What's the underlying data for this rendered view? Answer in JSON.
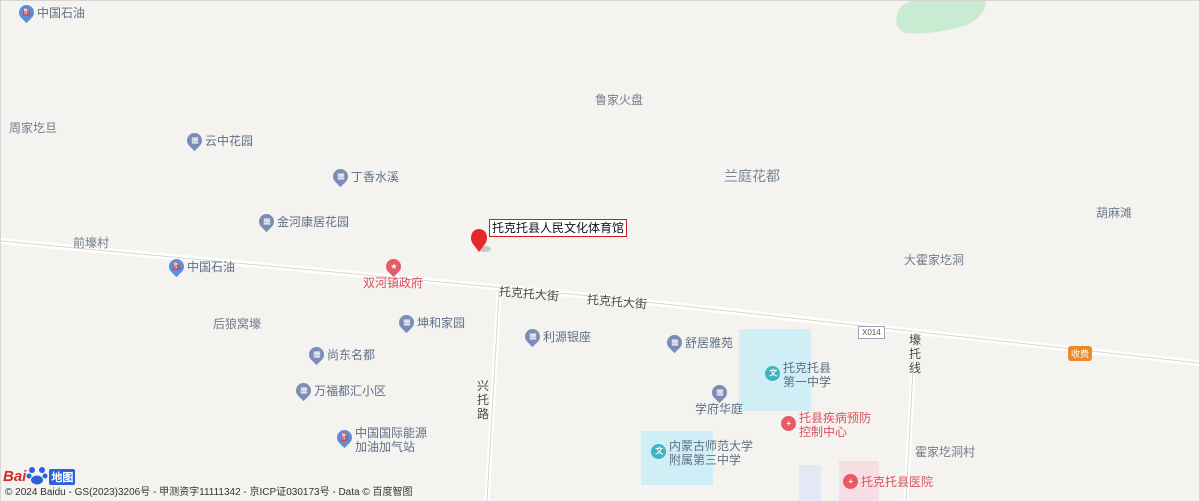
{
  "map": {
    "places": {
      "lujia": "鲁家火盘",
      "zhoujia": "周家圪旦",
      "lanting": "兰庭花都",
      "hulutan": "葫麻滩",
      "qianrang": "前壕村",
      "dahuojia": "大霍家圪洞",
      "houlang": "后狼窝壕",
      "huojiacun": "霍家圪洞村"
    },
    "roads": {
      "main1": "托克托大街",
      "main2": "托克托大街",
      "xingtuo": "兴托路",
      "rangtuo": "壕托线",
      "x014": "X014"
    },
    "pois": {
      "petro_top": "中国石油",
      "yunzhong": "云中花园",
      "dingxiang": "丁香水溪",
      "jinhe": "金河康居花园",
      "petro_mid": "中国石油",
      "shuanghe": "双河镇政府",
      "kunhe": "坤和家园",
      "liyuan": "利源银座",
      "shuju": "舒居雅苑",
      "shangdong": "尚东名都",
      "wanfu": "万福都汇小区",
      "xuefu": "学府华庭",
      "energy_1": "中国国际能源",
      "energy_2": "加油加气站",
      "school1_1": "托克托县",
      "school1_2": "第一中学",
      "cdc_1": "托县疾病预防",
      "cdc_2": "控制中心",
      "school3_1": "内蒙古师范大学",
      "school3_2": "附属第三中学",
      "hospital": "托克托县医院"
    },
    "target_label": "托克托县人民文化体育馆",
    "toll": "收费",
    "icons": {
      "residential": "building-icon",
      "gas": "gas-station-icon",
      "gov": "government-icon",
      "school": "school-icon",
      "hospital": "hospital-icon",
      "marker": "location-marker-icon"
    },
    "colors": {
      "background": "#f4f3ef",
      "water": "#cfeef5",
      "green": "#c9ebd2",
      "marker": "#e8262d"
    }
  },
  "footer": {
    "logo_text": "Bai",
    "logo_suffix": "地图",
    "copyright": "© 2024 Baidu - GS(2023)3206号 - 甲测资字11111342 - 京ICP证030173号 - Data © 百度智图"
  }
}
